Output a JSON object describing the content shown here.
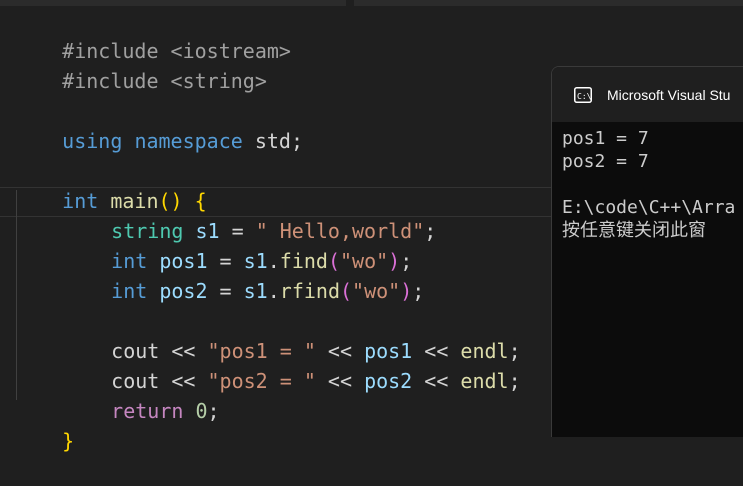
{
  "editor": {
    "lines": {
      "l1": {
        "a": "#include",
        "b": " ",
        "c": "<iostream>"
      },
      "l2": {
        "a": "#include",
        "b": " ",
        "c": "<string>"
      },
      "l4": {
        "a": "using",
        "b": " ",
        "c": "namespace",
        "d": " std;"
      },
      "l6": {
        "a": "int",
        "b": " ",
        "c": "main",
        "d": "()",
        "e": " ",
        "f": "{"
      },
      "l7": {
        "a": "string",
        "b": " ",
        "c": "s1",
        "d": " = ",
        "e": "\" Hello,world\"",
        "f": ";"
      },
      "l8": {
        "a": "int",
        "b": " ",
        "c": "pos1",
        "d": " = ",
        "e": "s1",
        "f": ".",
        "g": "find",
        "h": "(",
        "i": "\"wo\"",
        "j": ")",
        "k": ";"
      },
      "l9": {
        "a": "int",
        "b": " ",
        "c": "pos2",
        "d": " = ",
        "e": "s1",
        "f": ".",
        "g": "rfind",
        "h": "(",
        "i": "\"wo\"",
        "j": ")",
        "k": ";"
      },
      "l11": {
        "a": "cout",
        "b": " << ",
        "c": "\"pos1 = \"",
        "d": " << ",
        "e": "pos1",
        "f": " << ",
        "g": "endl",
        "h": ";"
      },
      "l12": {
        "a": "cout",
        "b": " << ",
        "c": "\"pos2 = \"",
        "d": " << ",
        "e": "pos2",
        "f": " << ",
        "g": "endl",
        "h": ";"
      },
      "l13": {
        "a": "return",
        "b": " ",
        "c": "0",
        "d": ";"
      },
      "l14": {
        "a": "}"
      }
    }
  },
  "terminal": {
    "icon": "console-icon",
    "title": "Microsoft Visual Stu",
    "output": [
      "pos1 = 7",
      "pos2 = 7",
      "",
      "E:\\code\\C++\\Arra",
      "按任意键关闭此窗"
    ]
  },
  "colors": {
    "editor_bg": "#1f1f1f",
    "keyword": "#569cd6",
    "type": "#4ec9b0",
    "function": "#dcdcaa",
    "variable": "#9cdcfe",
    "string": "#ce9178",
    "number": "#b5cea8",
    "terminal_bg": "#0c0c0c"
  }
}
